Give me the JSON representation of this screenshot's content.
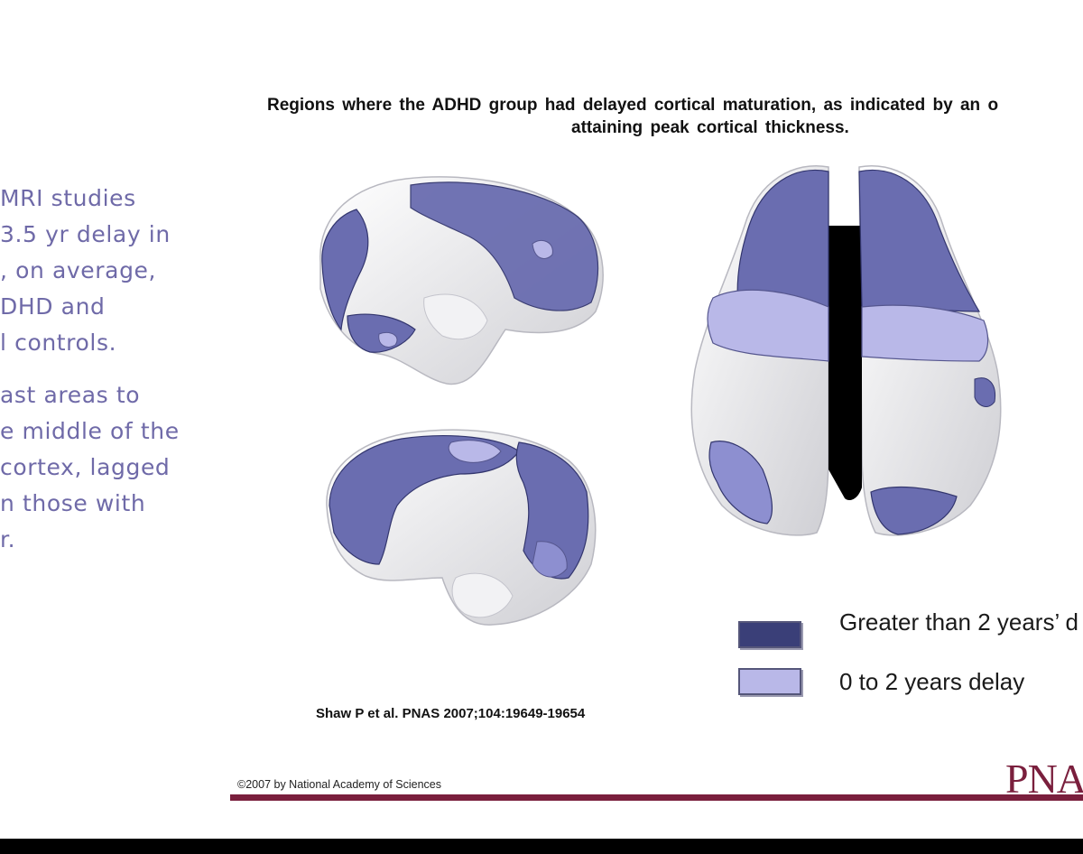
{
  "left_text": {
    "para1": [
      "MRI studies",
      "3.5 yr delay in",
      ", on average,",
      "DHD and",
      "l controls."
    ],
    "para2": [
      "ast areas to",
      "e middle of the",
      "cortex, lagged",
      "n those with",
      "r."
    ]
  },
  "figure": {
    "title_line1": "Regions where the ADHD group had delayed cortical maturation, as indicated by an o",
    "title_line2": "attaining peak cortical thickness."
  },
  "legend": {
    "greater": {
      "label": "Greater than 2 years’ d",
      "color": "#3a3f78"
    },
    "zero_to_two": {
      "label": "0 to 2 years delay",
      "color": "#b9b8e8"
    }
  },
  "citation": "Shaw P et al. PNAS 2007;104:19649-19654",
  "copyright": "©2007 by National Academy of Sciences",
  "logo": "PNAS",
  "colors": {
    "accent_text": "#6f6aa8",
    "delay_dark": "#3a3f78",
    "delay_light": "#b9b8e8",
    "brand_rule": "#7a1f3d"
  }
}
